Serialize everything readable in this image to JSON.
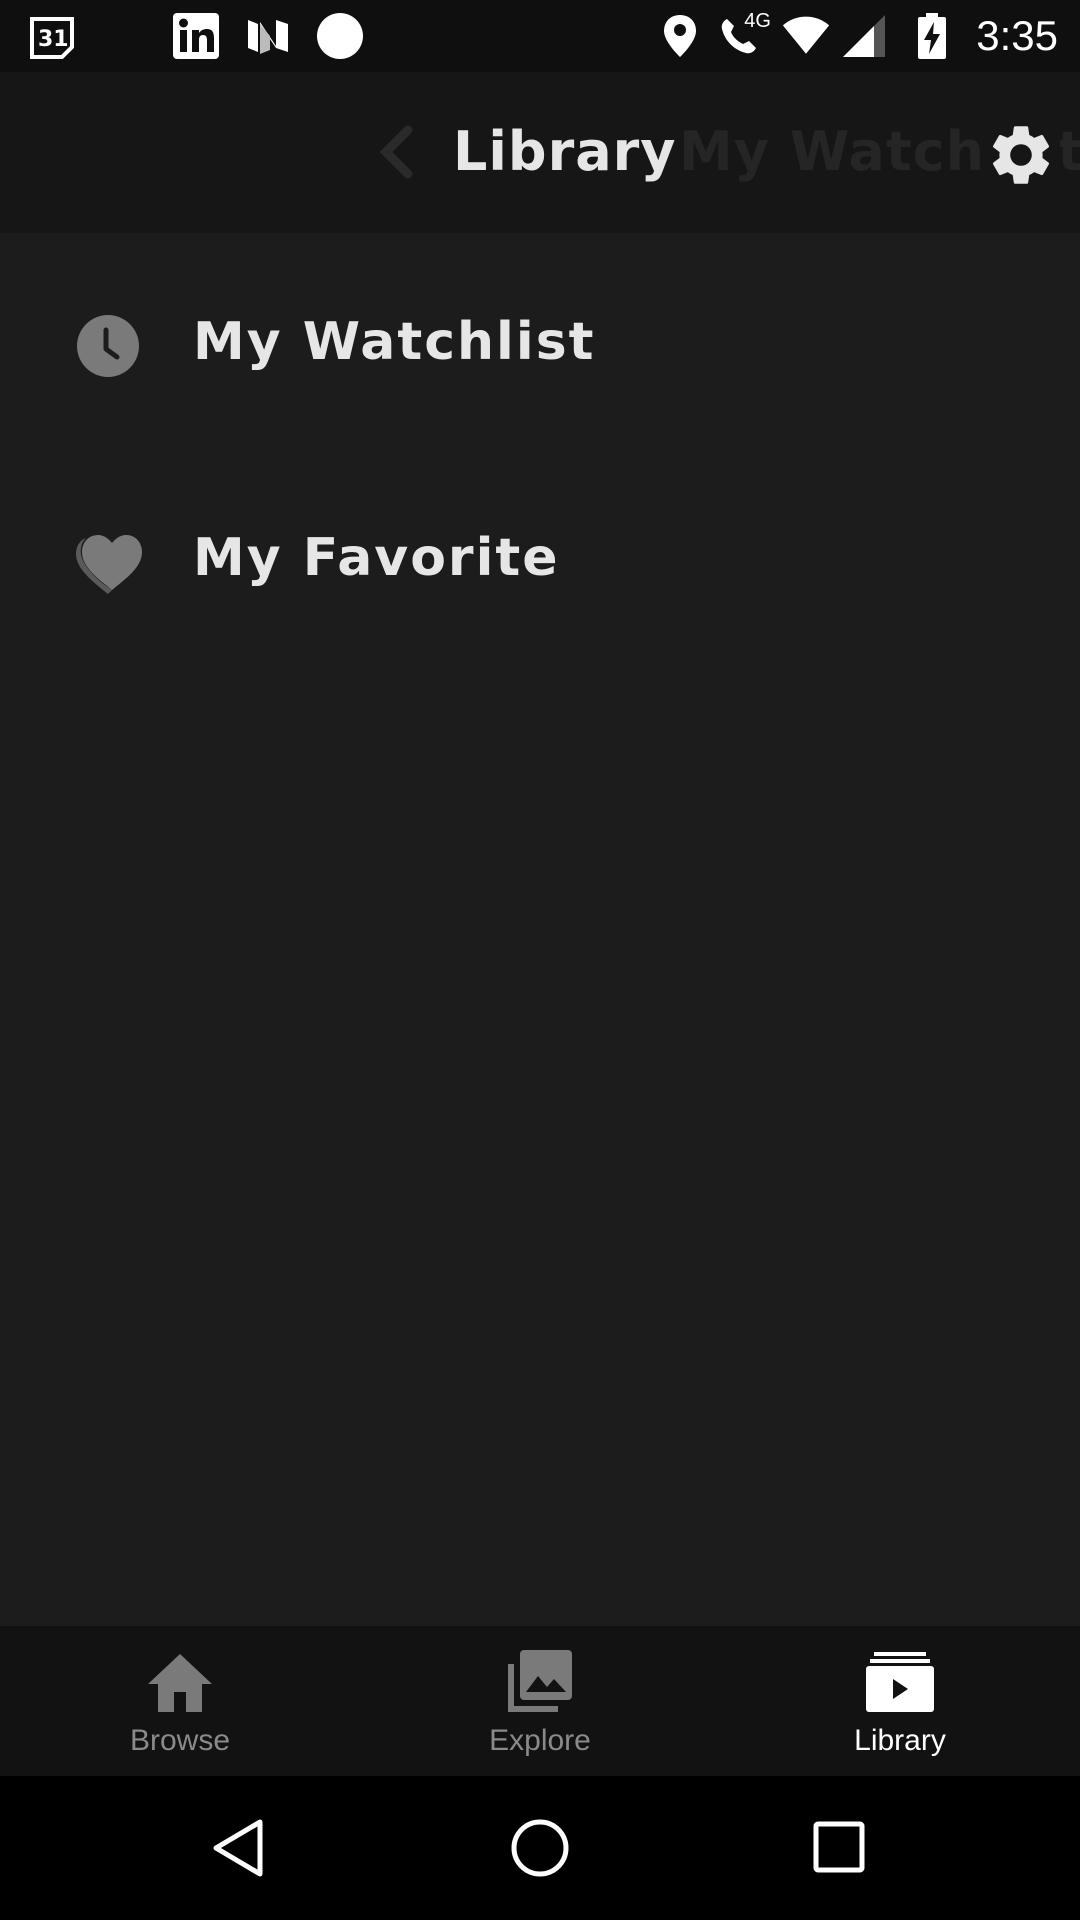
{
  "status_bar": {
    "time": "3:35",
    "left_icons": [
      "calendar-icon",
      "linkedin-icon",
      "news-icon",
      "circle-dot-icon"
    ],
    "calendar_day": "31",
    "right_icons": [
      "location-icon",
      "wifi-call-icon",
      "wifi-icon",
      "signal-icon",
      "battery-charging-icon"
    ],
    "network_label": "4G"
  },
  "app_bar": {
    "title": "Library",
    "next_title": "My Watchlist",
    "back_icon": "chevron-left-icon",
    "settings_icon": "gear-icon"
  },
  "library_list": [
    {
      "label": "My Watchlist",
      "icon": "clock-icon"
    },
    {
      "label": "My Favorite",
      "icon": "heart-icon"
    }
  ],
  "bottom_nav": [
    {
      "label": "Browse",
      "icon": "home-icon",
      "active": false
    },
    {
      "label": "Explore",
      "icon": "photo-library-icon",
      "active": false
    },
    {
      "label": "Library",
      "icon": "video-library-icon",
      "active": true
    }
  ],
  "system_nav": [
    "back-triangle-icon",
    "home-circle-icon",
    "recents-square-icon"
  ],
  "colors": {
    "background": "#1c1c1c",
    "app_bar": "#161616",
    "bottom_nav": "#121212",
    "status_bar": "#0f0f0f",
    "text_primary": "#e6e6e6",
    "text_inactive": "#8a8a8a",
    "icon_gray": "#7a7a7a"
  }
}
